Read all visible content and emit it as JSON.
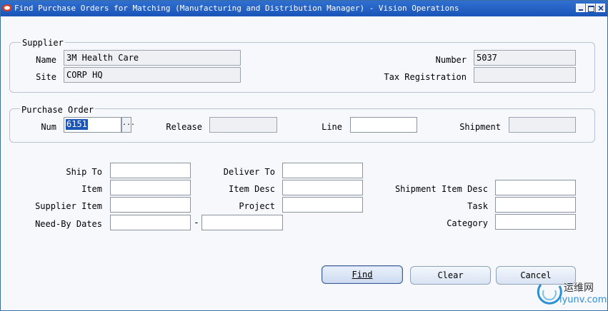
{
  "window": {
    "title": "Find Purchase Orders for Matching (Manufacturing and Distribution Manager) - Vision Operations"
  },
  "supplier": {
    "section_label": "Supplier",
    "name_label": "Name",
    "name_value": "3M Health Care",
    "site_label": "Site",
    "site_value": "CORP HQ",
    "number_label": "Number",
    "number_value": "5037",
    "tax_label": "Tax Registration",
    "tax_value": ""
  },
  "purchase_order": {
    "section_label": "Purchase Order",
    "num_label": "Num",
    "num_value": "6151",
    "lov_glyph": "...",
    "release_label": "Release",
    "release_value": "",
    "line_label": "Line",
    "line_value": "",
    "shipment_label": "Shipment",
    "shipment_value": ""
  },
  "criteria": {
    "ship_to_label": "Ship To",
    "deliver_to_label": "Deliver To",
    "item_label": "Item",
    "item_desc_label": "Item Desc",
    "shipment_item_desc_label": "Shipment Item Desc",
    "supplier_item_label": "Supplier Item",
    "project_label": "Project",
    "task_label": "Task",
    "need_by_label": "Need-By Dates",
    "range_separator": "-",
    "category_label": "Category"
  },
  "buttons": {
    "find": "Find",
    "clear": "Clear",
    "cancel": "Cancel"
  },
  "watermark": {
    "line1": "运维网",
    "line2": "iyunv.com"
  },
  "colors": {
    "titlebar": "#1a55b8",
    "group_border": "#b7c3d6",
    "selection": "#1a55b8"
  }
}
